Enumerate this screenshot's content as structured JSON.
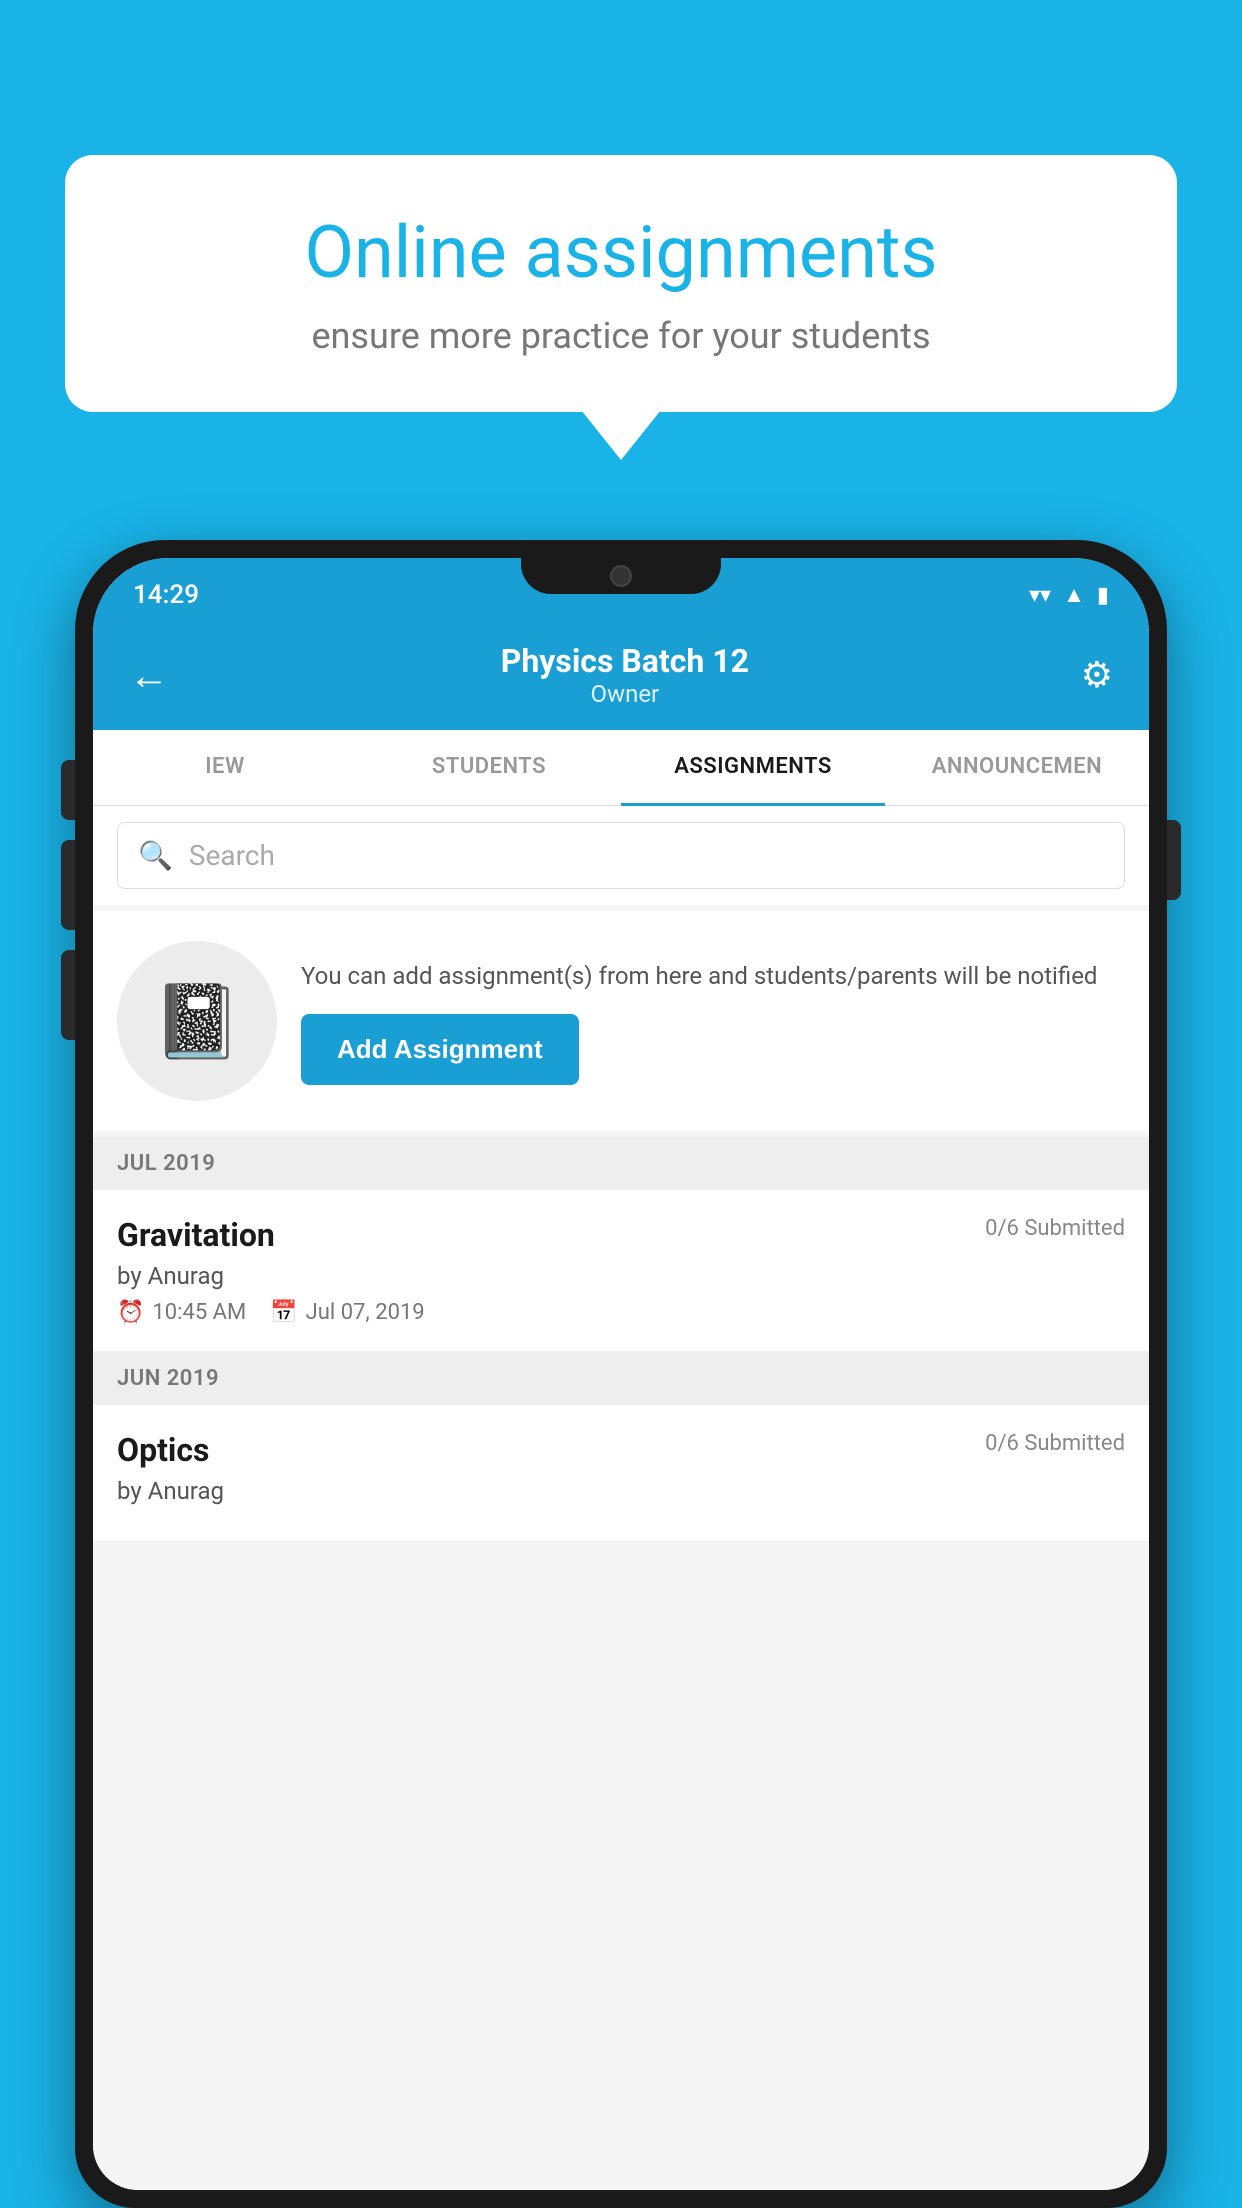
{
  "background_color": "#1ab3e8",
  "speech_bubble": {
    "title": "Online assignments",
    "subtitle": "ensure more practice for your students"
  },
  "status_bar": {
    "time": "14:29",
    "wifi": "▼",
    "signal": "▲",
    "battery": "▮"
  },
  "header": {
    "title": "Physics Batch 12",
    "subtitle": "Owner",
    "back_label": "←",
    "settings_label": "⚙"
  },
  "tabs": [
    {
      "label": "IEW",
      "active": false
    },
    {
      "label": "STUDENTS",
      "active": false
    },
    {
      "label": "ASSIGNMENTS",
      "active": true
    },
    {
      "label": "ANNOUNCEMEN",
      "active": false
    }
  ],
  "search": {
    "placeholder": "Search"
  },
  "add_assignment": {
    "description": "You can add assignment(s) from here and students/parents will be notified",
    "button_label": "Add Assignment"
  },
  "sections": [
    {
      "month": "JUL 2019",
      "assignments": [
        {
          "name": "Gravitation",
          "submitted": "0/6 Submitted",
          "author": "by Anurag",
          "time": "10:45 AM",
          "date": "Jul 07, 2019"
        }
      ]
    },
    {
      "month": "JUN 2019",
      "assignments": [
        {
          "name": "Optics",
          "submitted": "0/6 Submitted",
          "author": "by Anurag",
          "time": "",
          "date": ""
        }
      ]
    }
  ]
}
